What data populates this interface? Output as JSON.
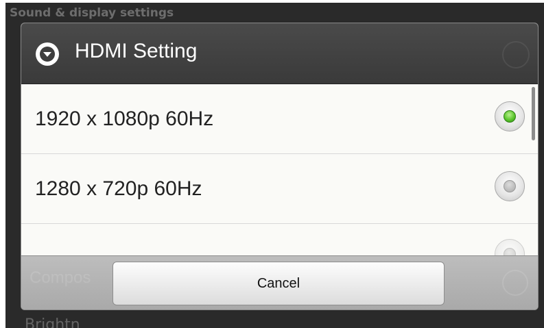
{
  "background": {
    "screen_title": "Sound & display settings",
    "partial_item": "Compos",
    "bottom_item": "Brightn"
  },
  "dialog": {
    "title": "HDMI Setting",
    "header_icon": "dropdown-circle-icon",
    "options": [
      {
        "label": "1920 x 1080p 60Hz",
        "selected": true
      },
      {
        "label": "1280 x 720p 60Hz",
        "selected": false
      }
    ],
    "cancel_label": "Cancel"
  },
  "colors": {
    "header_bg": "#3e3e3e",
    "list_bg": "#fafaf7",
    "selected_radio": "#5cc62e",
    "button_bar_bg": "#b3b3b3"
  }
}
